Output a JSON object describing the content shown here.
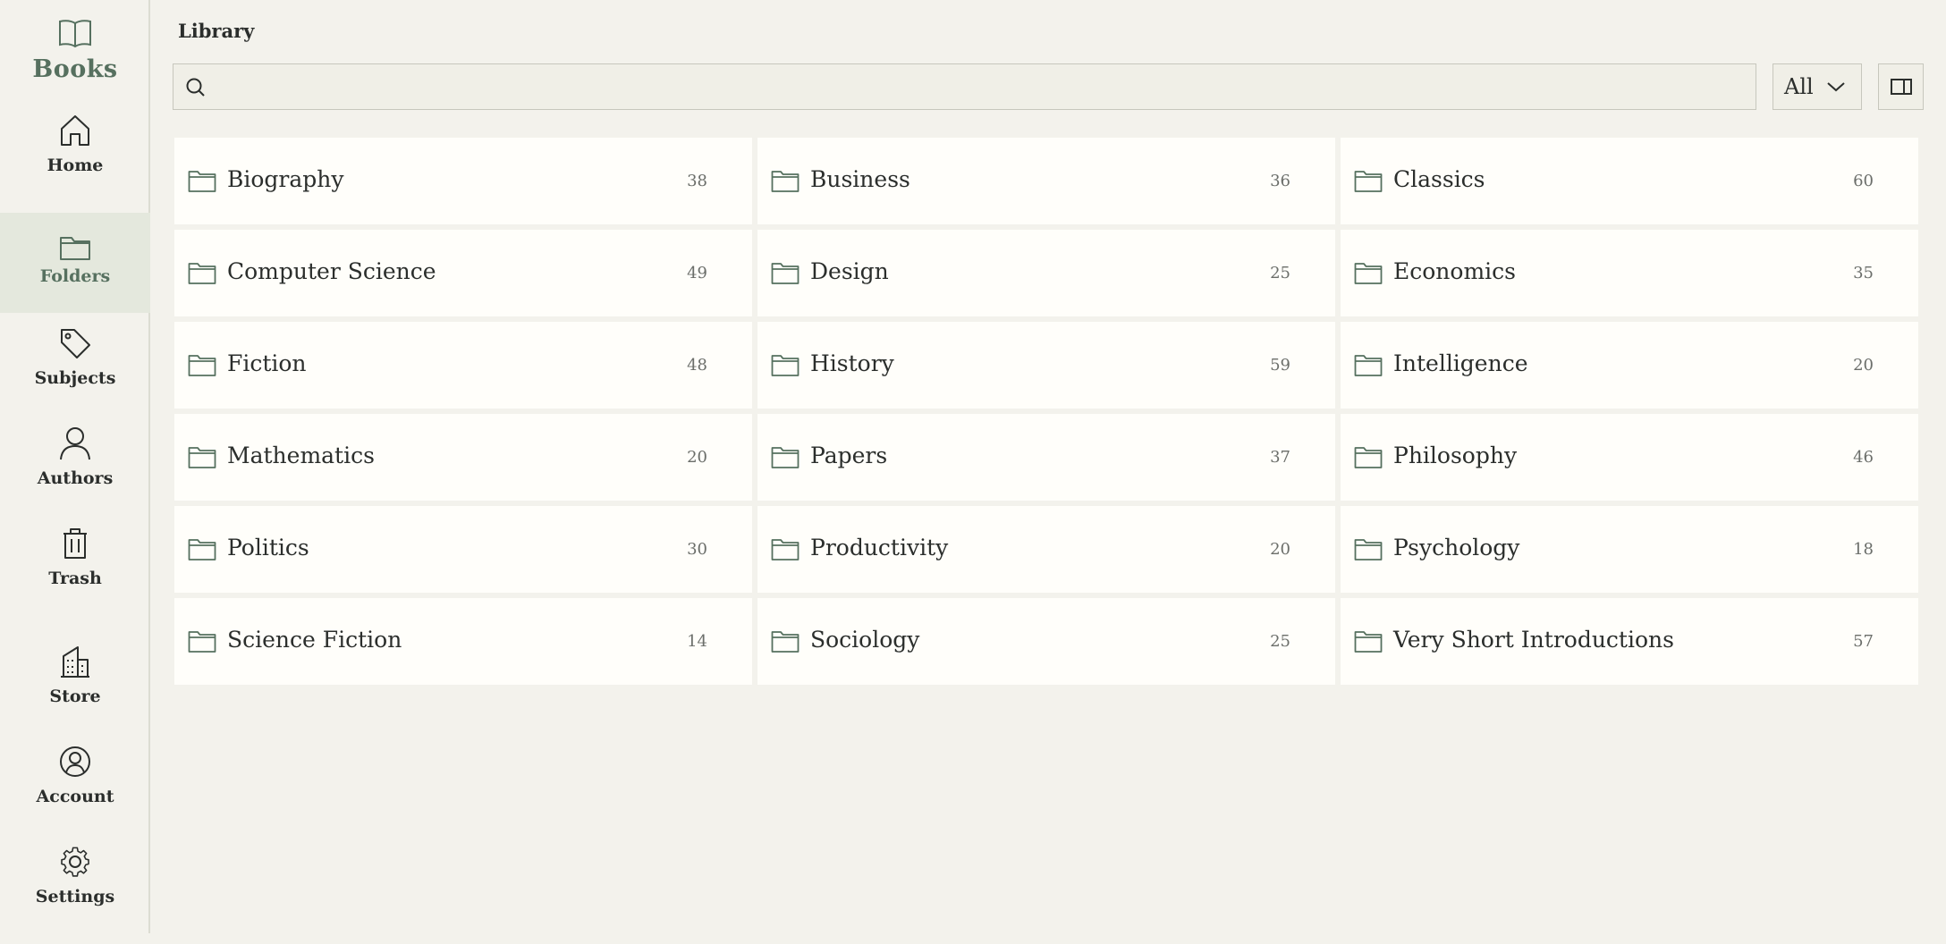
{
  "app": {
    "name": "Books"
  },
  "nav": [
    {
      "label": "Home",
      "icon": "home-icon",
      "active": false
    },
    {
      "label": "Folders",
      "icon": "folder-icon",
      "active": true
    },
    {
      "label": "Subjects",
      "icon": "tag-icon",
      "active": false
    },
    {
      "label": "Authors",
      "icon": "user-icon",
      "active": false
    },
    {
      "label": "Trash",
      "icon": "trash-icon",
      "active": false
    },
    {
      "label": "Store",
      "icon": "building-icon",
      "active": false
    },
    {
      "label": "Account",
      "icon": "account-circle-icon",
      "active": false
    },
    {
      "label": "Settings",
      "icon": "gear-icon",
      "active": false
    }
  ],
  "header": {
    "title": "Library"
  },
  "search": {
    "placeholder": "",
    "value": ""
  },
  "filter": {
    "selected": "All"
  },
  "folders": [
    {
      "name": "Biography",
      "count": "38"
    },
    {
      "name": "Business",
      "count": "36"
    },
    {
      "name": "Classics",
      "count": "60"
    },
    {
      "name": "Computer Science",
      "count": "49"
    },
    {
      "name": "Design",
      "count": "25"
    },
    {
      "name": "Economics",
      "count": "35"
    },
    {
      "name": "Fiction",
      "count": "48"
    },
    {
      "name": "History",
      "count": "59"
    },
    {
      "name": "Intelligence",
      "count": "20"
    },
    {
      "name": "Mathematics",
      "count": "20"
    },
    {
      "name": "Papers",
      "count": "37"
    },
    {
      "name": "Philosophy",
      "count": "46"
    },
    {
      "name": "Politics",
      "count": "30"
    },
    {
      "name": "Productivity",
      "count": "20"
    },
    {
      "name": "Psychology",
      "count": "18"
    },
    {
      "name": "Science Fiction",
      "count": "14"
    },
    {
      "name": "Sociology",
      "count": "25"
    },
    {
      "name": "Very Short Introductions",
      "count": "57"
    }
  ],
  "colors": {
    "accent": "#56705f",
    "background": "#f3f2ec",
    "card": "#fffefa",
    "active_nav": "#e4e8dd"
  }
}
